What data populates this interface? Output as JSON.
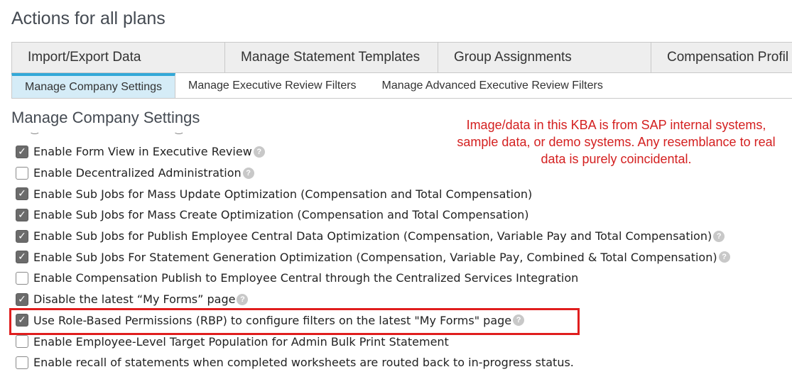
{
  "page_title": "Actions for all plans",
  "tabs": [
    {
      "label": "Import/Export Data"
    },
    {
      "label": "Manage Statement Templates"
    },
    {
      "label": "Group Assignments"
    },
    {
      "label": "Compensation Profil"
    }
  ],
  "sub_tabs": [
    {
      "label": "Manage Company Settings",
      "active": true
    },
    {
      "label": "Manage Executive Review Filters",
      "active": false
    },
    {
      "label": "Manage Advanced Executive Review Filters",
      "active": false
    }
  ],
  "section_title": "Manage Company Settings",
  "disclaimer": "Image/data in this KBA is from SAP internal systems, sample data, or demo systems. Any resemblance to real data is purely coincidental.",
  "options": [
    {
      "label": "Enable Form View in Executive Review",
      "checked": true,
      "help": true
    },
    {
      "label": "Enable Decentralized Administration",
      "checked": false,
      "help": true
    },
    {
      "label": "Enable Sub Jobs for Mass Update Optimization (Compensation and Total Compensation)",
      "checked": true,
      "help": false
    },
    {
      "label": "Enable Sub Jobs for Mass Create Optimization (Compensation and Total Compensation)",
      "checked": true,
      "help": false
    },
    {
      "label": "Enable Sub Jobs for Publish Employee Central Data Optimization (Compensation, Variable Pay and Total Compensation)",
      "checked": true,
      "help": true
    },
    {
      "label": "Enable Sub Jobs For Statement Generation Optimization (Compensation, Variable Pay, Combined & Total Compensation)",
      "checked": true,
      "help": true
    },
    {
      "label": "Enable Compensation Publish to Employee Central through the Centralized Services Integration",
      "checked": false,
      "help": false
    },
    {
      "label": "Disable the latest “My Forms” page",
      "checked": true,
      "help": true
    },
    {
      "label": "Use Role-Based Permissions (RBP) to configure filters on the latest \"My Forms\" page",
      "checked": true,
      "help": true
    },
    {
      "label": "Enable Employee-Level Target Population for Admin Bulk Print Statement",
      "checked": false,
      "help": false
    },
    {
      "label": "Enable recall of statements when completed worksheets are routed back to in-progress status.",
      "checked": false,
      "help": false
    }
  ],
  "highlight_color": "#e01e1e",
  "disclaimer_color": "#d42020",
  "active_subtab_color": "#d5ecf7"
}
